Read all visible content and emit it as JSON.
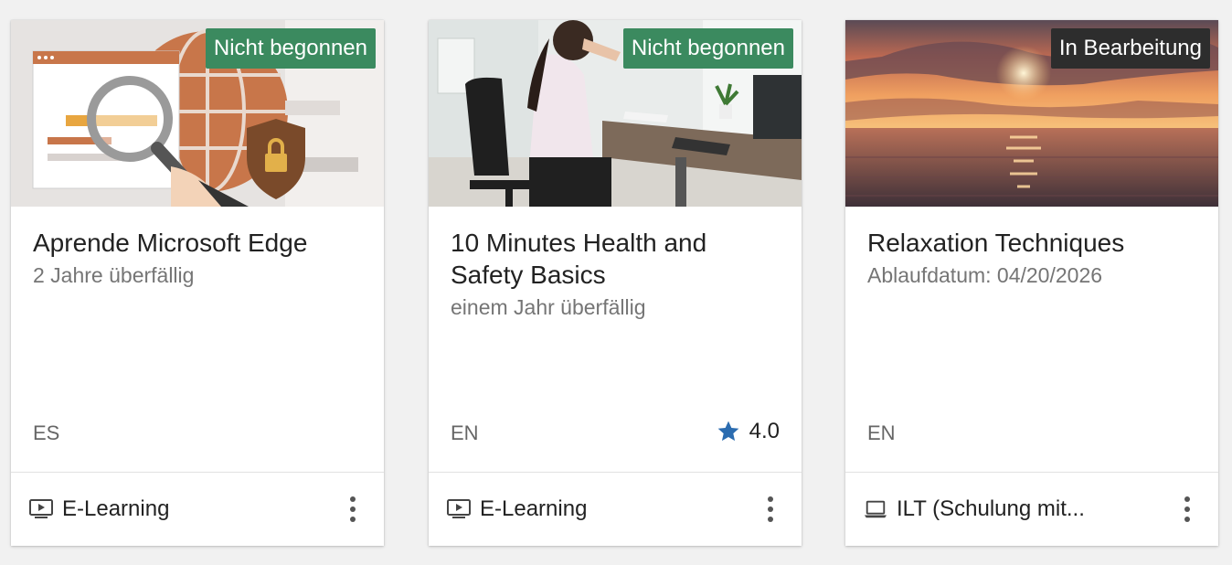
{
  "cards": [
    {
      "badge": "Nicht begonnen",
      "badge_color": "#3b8a5f",
      "title": "Aprende Microsoft Edge",
      "subtitle": "2 Jahre überfällig",
      "language": "ES",
      "type_icon": "video-play-icon",
      "type_label": "E-Learning"
    },
    {
      "badge": "Nicht begonnen",
      "badge_color": "#3b8a5f",
      "title": "10 Minutes Health and Safety Basics",
      "subtitle": "einem Jahr überfällig",
      "language": "EN",
      "rating": "4.0",
      "rating_star_color": "#2b6cb0",
      "type_icon": "video-play-icon",
      "type_label": "E-Learning"
    },
    {
      "badge": "In Bearbeitung",
      "badge_color": "#2d2d2d",
      "title": "Relaxation Techniques",
      "subtitle": "Ablaufdatum: 04/20/2026",
      "language": "EN",
      "type_icon": "laptop-icon",
      "type_label": "ILT (Schulung mit..."
    }
  ]
}
